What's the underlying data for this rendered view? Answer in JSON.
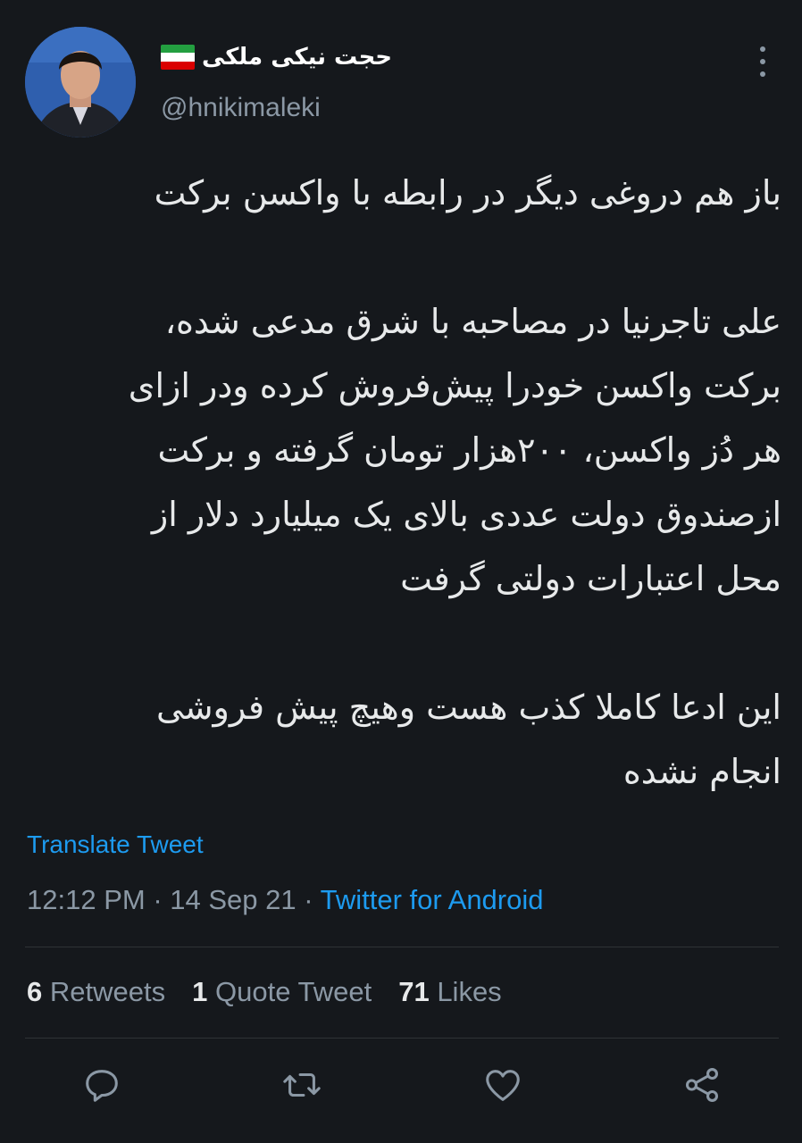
{
  "author": {
    "name": "حجت نیکی ملکی",
    "handle": "@hnikimaleki",
    "flag_colors": [
      "#239f40",
      "#ffffff",
      "#da0000"
    ]
  },
  "tweet": {
    "paragraphs": [
      [
        "باز هم دروغی دیگر در رابطه با واکسن برکت"
      ],
      [
        "علی تاجرنیا در مصاحبه با شرق مدعی شده،",
        "برکت واکسن خودرا پیش‌فروش کرده ودر ازای",
        "هر دُز واکسن، ۲۰۰هزار تومان گرفته و برکت",
        "ازصندوق دولت عددی بالای یک میلیارد دلار از",
        "محل اعتبارات دولتی گرفت"
      ],
      [
        "این ادعا کاملا کذب هست وهیچ پیش فروشی",
        "انجام نشده"
      ]
    ]
  },
  "translate_label": "Translate Tweet",
  "meta": {
    "time": "12:12 PM",
    "date": "14 Sep 21",
    "separator": "·",
    "app": "Twitter for Android"
  },
  "stats": {
    "retweets_count": "6",
    "retweets_label": "Retweets",
    "quotes_count": "1",
    "quotes_label": "Quote Tweet",
    "likes_count": "71",
    "likes_label": "Likes"
  },
  "actions": [
    "reply-icon",
    "retweet-icon",
    "like-icon",
    "share-icon"
  ],
  "colors": {
    "background": "#15181c",
    "accent": "#1d9bf0",
    "muted": "#8b98a5",
    "text": "#e7e9ea"
  }
}
